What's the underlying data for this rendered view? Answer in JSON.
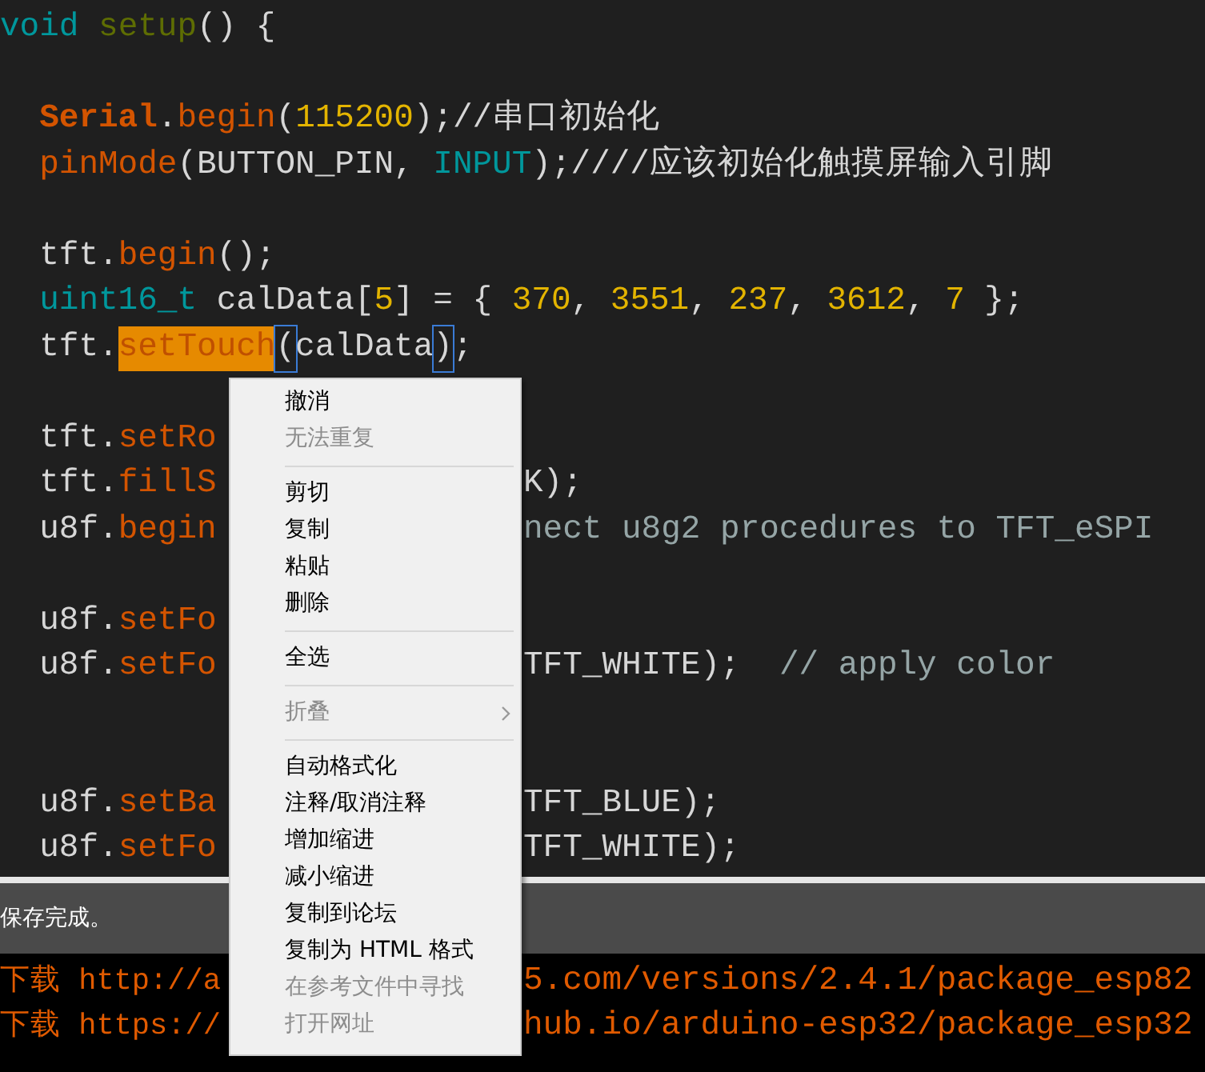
{
  "code": {
    "lines": [
      {
        "kind": "code",
        "segments": [
          {
            "text": "void",
            "kind": "keyword"
          },
          {
            "text": " setup",
            "kind": "name"
          },
          {
            "text": "() {",
            "kind": "plain"
          }
        ]
      },
      {
        "kind": "blank"
      },
      {
        "kind": "code",
        "segments": [
          {
            "text": "  Serial",
            "kind": "class"
          },
          {
            "text": ".",
            "kind": "plain"
          },
          {
            "text": "begin",
            "kind": "function"
          },
          {
            "text": "(",
            "kind": "plain"
          },
          {
            "text": "115200",
            "kind": "number"
          },
          {
            "text": ");//串口初始化",
            "kind": "plain"
          }
        ]
      },
      {
        "kind": "code",
        "segments": [
          {
            "text": "  pinMode",
            "kind": "function"
          },
          {
            "text": "(BUTTON_PIN, ",
            "kind": "plain"
          },
          {
            "text": "INPUT",
            "kind": "keyword"
          },
          {
            "text": ");////应该初始化触摸屏输入引脚",
            "kind": "plain"
          }
        ]
      },
      {
        "kind": "blank"
      },
      {
        "kind": "code",
        "segments": [
          {
            "text": "  tft.",
            "kind": "plain"
          },
          {
            "text": "begin",
            "kind": "function"
          },
          {
            "text": "();",
            "kind": "plain"
          }
        ]
      },
      {
        "kind": "code",
        "segments": [
          {
            "text": "  uint16_t",
            "kind": "keyword"
          },
          {
            "text": " calData[",
            "kind": "plain"
          },
          {
            "text": "5",
            "kind": "number"
          },
          {
            "text": "] = { ",
            "kind": "plain"
          },
          {
            "text": "370",
            "kind": "number"
          },
          {
            "text": ", ",
            "kind": "plain"
          },
          {
            "text": "3551",
            "kind": "number"
          },
          {
            "text": ", ",
            "kind": "plain"
          },
          {
            "text": "237",
            "kind": "number"
          },
          {
            "text": ", ",
            "kind": "plain"
          },
          {
            "text": "3612",
            "kind": "number"
          },
          {
            "text": ", ",
            "kind": "plain"
          },
          {
            "text": "7",
            "kind": "number"
          },
          {
            "text": " };",
            "kind": "plain"
          }
        ]
      },
      {
        "kind": "code",
        "segments": [
          {
            "text": "  tft.",
            "kind": "plain"
          },
          {
            "text": "setTouch",
            "kind": "highlight"
          },
          {
            "text": "(",
            "kind": "bracket"
          },
          {
            "text": "calData",
            "kind": "plain"
          },
          {
            "text": ")",
            "kind": "bracket"
          },
          {
            "text": ";",
            "kind": "plain"
          }
        ]
      },
      {
        "kind": "blank"
      },
      {
        "kind": "code",
        "segments": [
          {
            "text": "  tft.",
            "kind": "plain"
          },
          {
            "text": "setRo",
            "kind": "function"
          }
        ]
      },
      {
        "kind": "code",
        "segments": [
          {
            "text": "  tft.",
            "kind": "plain"
          },
          {
            "text": "fillS",
            "kind": "function"
          }
        ],
        "right": [
          {
            "text": "K);",
            "kind": "plain"
          }
        ]
      },
      {
        "kind": "code",
        "segments": [
          {
            "text": "  u8f.",
            "kind": "plain"
          },
          {
            "text": "begin",
            "kind": "function"
          }
        ],
        "right": [
          {
            "text": "nect u8g2 procedures to TFT_eSPI",
            "kind": "comment"
          }
        ]
      },
      {
        "kind": "blank"
      },
      {
        "kind": "code",
        "segments": [
          {
            "text": "  u8f.",
            "kind": "plain"
          },
          {
            "text": "setFo",
            "kind": "function"
          }
        ]
      },
      {
        "kind": "code",
        "segments": [
          {
            "text": "  u8f.",
            "kind": "plain"
          },
          {
            "text": "setFo",
            "kind": "function"
          }
        ],
        "right": [
          {
            "text": "TFT_WHITE);  ",
            "kind": "plain"
          },
          {
            "text": "// apply color",
            "kind": "comment"
          }
        ]
      },
      {
        "kind": "blank"
      },
      {
        "kind": "blank"
      },
      {
        "kind": "code",
        "segments": [
          {
            "text": "  u8f.",
            "kind": "plain"
          },
          {
            "text": "setBa",
            "kind": "function"
          }
        ],
        "right": [
          {
            "text": "TFT_BLUE);",
            "kind": "plain"
          }
        ]
      },
      {
        "kind": "code",
        "segments": [
          {
            "text": "  u8f.",
            "kind": "plain"
          },
          {
            "text": "setFo",
            "kind": "function"
          }
        ],
        "right": [
          {
            "text": "TFT_WHITE);",
            "kind": "plain"
          }
        ]
      }
    ]
  },
  "status_bar": {
    "text": "保存完成。"
  },
  "console": {
    "lines": [
      {
        "left": "下载 http://a",
        "right": "5.com/versions/2.4.1/package_esp82"
      },
      {
        "left": "下载 https://",
        "right": "hub.io/arduino-esp32/package_esp32"
      }
    ]
  },
  "context_menu": {
    "items": [
      {
        "kind": "item",
        "label": "撤消",
        "disabled": false
      },
      {
        "kind": "item",
        "label": "无法重复",
        "disabled": true
      },
      {
        "kind": "separator"
      },
      {
        "kind": "item",
        "label": "剪切",
        "disabled": false
      },
      {
        "kind": "item",
        "label": "复制",
        "disabled": false
      },
      {
        "kind": "item",
        "label": "粘贴",
        "disabled": false
      },
      {
        "kind": "item",
        "label": "删除",
        "disabled": false
      },
      {
        "kind": "separator"
      },
      {
        "kind": "item",
        "label": "全选",
        "disabled": false
      },
      {
        "kind": "separator"
      },
      {
        "kind": "submenu",
        "label": "折叠",
        "disabled": true
      },
      {
        "kind": "separator"
      },
      {
        "kind": "item",
        "label": "自动格式化",
        "disabled": false
      },
      {
        "kind": "item",
        "label": "注释/取消注释",
        "disabled": false
      },
      {
        "kind": "item",
        "label": "增加缩进",
        "disabled": false
      },
      {
        "kind": "item",
        "label": "减小缩进",
        "disabled": false
      },
      {
        "kind": "item",
        "label": "复制到论坛",
        "disabled": false
      },
      {
        "kind": "item",
        "label": "复制为 HTML 格式",
        "disabled": false
      },
      {
        "kind": "item",
        "label": "在参考文件中寻找",
        "disabled": true
      },
      {
        "kind": "item",
        "label": "打开网址",
        "disabled": true
      }
    ]
  }
}
